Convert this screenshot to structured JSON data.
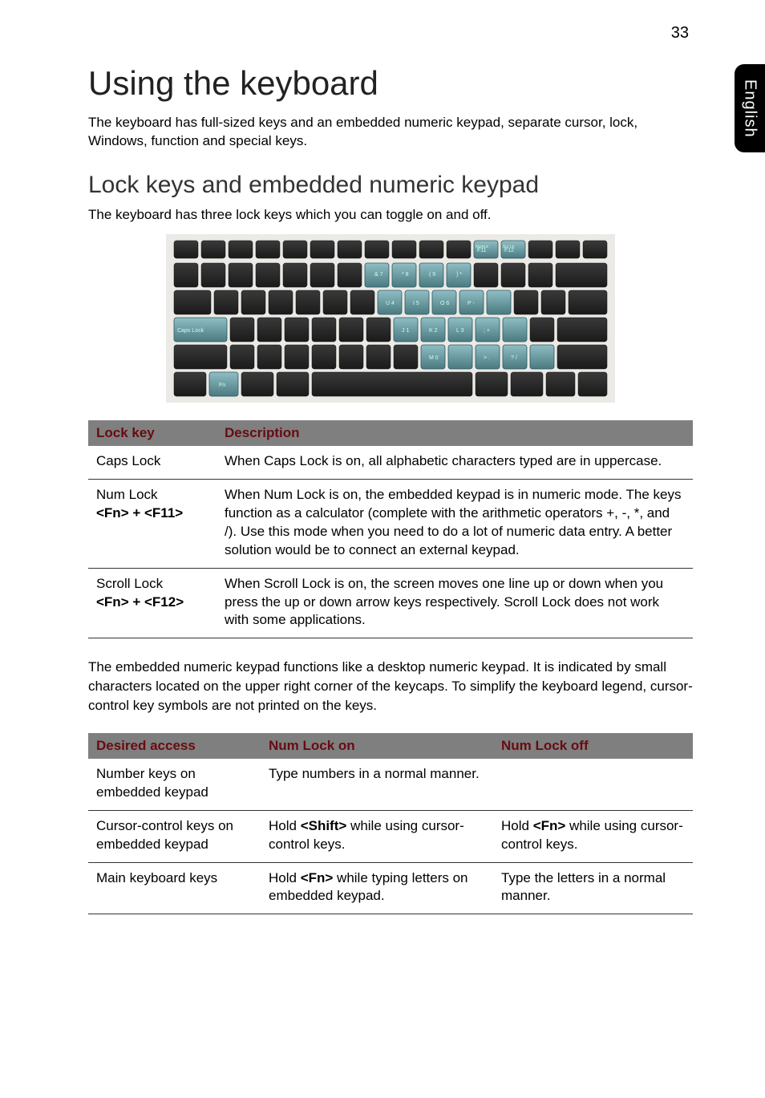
{
  "page_number": "33",
  "side_tab": "English",
  "h1": "Using the keyboard",
  "intro": "The keyboard has full-sized keys and an embedded numeric keypad, separate cursor, lock, Windows, function and special keys.",
  "h2": "Lock keys and embedded numeric keypad",
  "sub": "The keyboard has three lock keys which you can toggle on and off.",
  "table1": {
    "head": {
      "c1": "Lock key",
      "c2": "Description"
    },
    "rows": [
      {
        "c1": "Caps Lock",
        "c2": "When Caps Lock is on, all alphabetic characters typed are in uppercase."
      },
      {
        "c1_line1": "Num Lock",
        "c1_line2": "<Fn> + <F11>",
        "c2": "When Num Lock is on, the embedded keypad is in numeric mode. The keys function as a calculator (complete with the arithmetic operators +, -, *, and /). Use this mode when you need to do a lot of numeric data entry. A better solution would be to connect an external keypad."
      },
      {
        "c1_line1": "Scroll Lock",
        "c1_line2": "<Fn> + <F12>",
        "c2": "When Scroll Lock is on, the screen moves one line up or down when you press the up or down arrow keys respectively. Scroll Lock does not work with some applications."
      }
    ]
  },
  "para": "The embedded numeric keypad functions like a desktop numeric keypad. It is indicated by small characters located on the upper right corner of the keycaps. To simplify the keyboard legend, cursor-control key symbols are not printed on the keys.",
  "table2": {
    "head": {
      "c1": "Desired access",
      "c2": "Num Lock on",
      "c3": "Num Lock off"
    },
    "rows": [
      {
        "c1": "Number keys on embedded keypad",
        "c2": "Type numbers in a normal manner.",
        "c3": ""
      },
      {
        "c1": "Cursor-control keys on embedded keypad",
        "c2_pre": "Hold ",
        "c2_key": "<Shift>",
        "c2_post": " while using cursor-control keys.",
        "c3_pre": "Hold ",
        "c3_key": "<Fn>",
        "c3_post": " while using cursor-control keys."
      },
      {
        "c1": "Main keyboard keys",
        "c2_pre": "Hold ",
        "c2_key": "<Fn>",
        "c2_post": " while typing letters on embedded keypad.",
        "c3": "Type the letters in a normal manner."
      }
    ]
  }
}
